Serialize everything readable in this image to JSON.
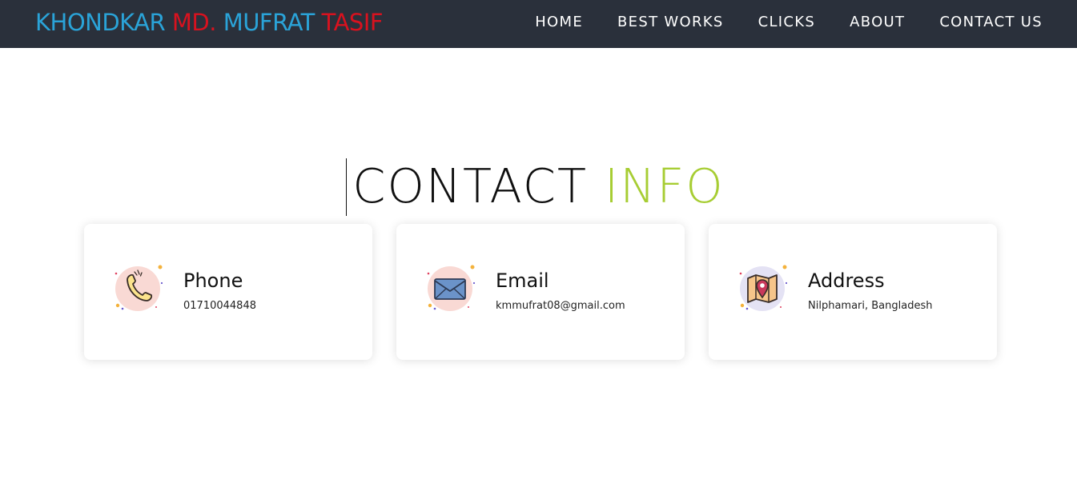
{
  "brand": {
    "part1": "KHONDKAR",
    "part2": "MD.",
    "part3": "MUFRAT",
    "part4": "TASIF"
  },
  "nav": {
    "items": [
      {
        "label": "HOME"
      },
      {
        "label": "BEST WORKS"
      },
      {
        "label": "CLICKS"
      },
      {
        "label": "ABOUT"
      },
      {
        "label": "CONTACT US"
      }
    ]
  },
  "heading": {
    "part1": "CONTACT",
    "part2": "INFO"
  },
  "cards": [
    {
      "icon": "phone-icon",
      "title": "Phone",
      "value": "01710044848"
    },
    {
      "icon": "envelope-icon",
      "title": "Email",
      "value": "kmmufrat08@gmail.com"
    },
    {
      "icon": "map-pin-icon",
      "title": "Address",
      "value": "Nilphamari, Bangladesh"
    }
  ],
  "colors": {
    "navbar": "#2a303b",
    "brand_blue": "#2aa3d8",
    "brand_red": "#d8121f",
    "heading_accent": "#a7cd33"
  }
}
